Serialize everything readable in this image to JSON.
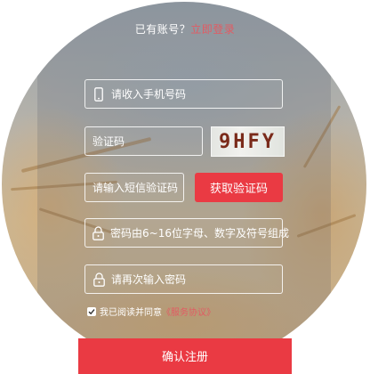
{
  "header": {
    "have_account_text": "已有账号？",
    "login_link": "立即登录"
  },
  "form": {
    "phone_placeholder": "请收入手机号码",
    "code_placeholder": "验证码",
    "captcha_text": "9HFY",
    "sms_code_placeholder": "请输入短信验证码",
    "get_code_button": "获取验证码",
    "password_placeholder": "密码由6~16位字母、数字及符号组成",
    "confirm_password_placeholder": "请再次输入密码",
    "agree_text": "我已阅读并同意",
    "agreement_link": "《服务协议》",
    "agree_checked": true,
    "submit_button": "确认注册"
  },
  "colors": {
    "accent": "#ea3a43",
    "link": "#e25b63"
  },
  "icons": {
    "phone": "mobile-phone-icon",
    "lock": "lock-icon",
    "check": "checkmark-icon"
  }
}
